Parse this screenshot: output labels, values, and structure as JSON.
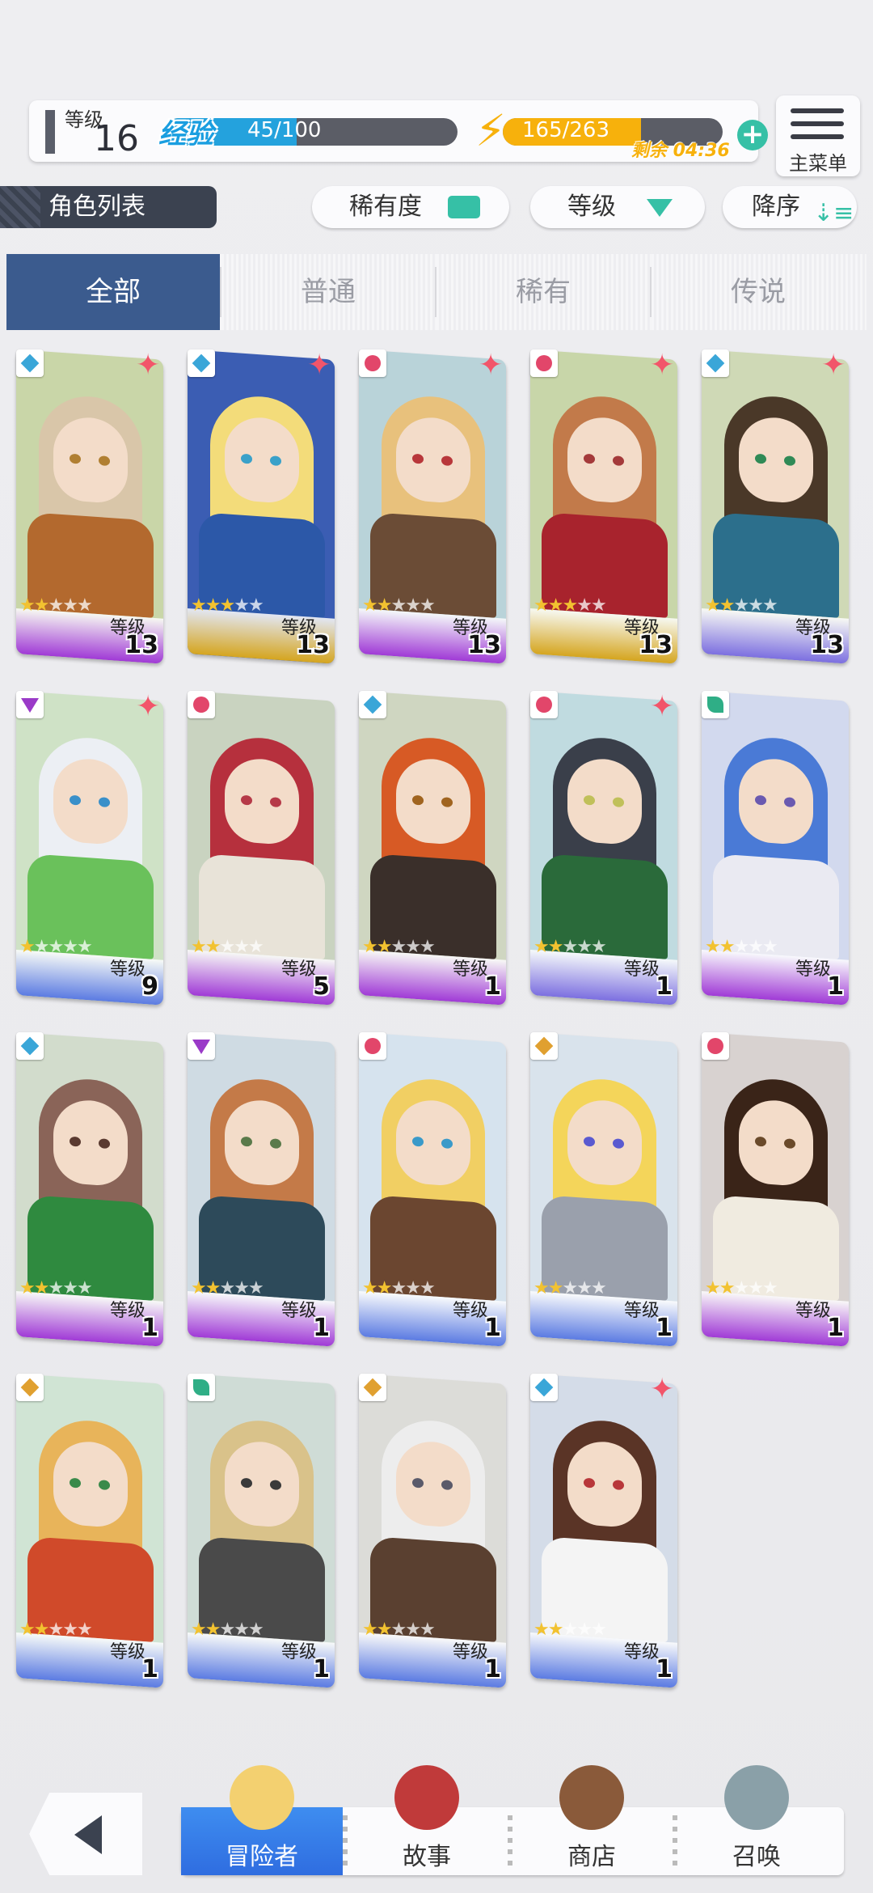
{
  "status": {
    "level_label": "等级",
    "level_value": "16",
    "exp_label": "经验",
    "exp_text": "45/100",
    "exp_progress": 0.45,
    "energy_text": "165/263",
    "energy_progress": 0.63,
    "remain_text": "剩余 04:36"
  },
  "main_menu": {
    "label": "主菜单"
  },
  "section_title": "角色列表",
  "sort": {
    "rarity_label": "稀有度",
    "level_label": "等级",
    "order_label": "降序"
  },
  "tabs": [
    {
      "label": "全部",
      "active": true
    },
    {
      "label": "普通",
      "active": false
    },
    {
      "label": "稀有",
      "active": false
    },
    {
      "label": "传说",
      "active": false
    }
  ],
  "cards": [
    {
      "attr": "water",
      "new": true,
      "stars": 2,
      "level_label": "等级",
      "level": "13",
      "band": "#a03ad6",
      "hair": "#d9c6a9",
      "outfit": "#b3692e",
      "eye": "#b07f32",
      "bg": "#c9d6a8"
    },
    {
      "attr": "water",
      "new": true,
      "stars": 3,
      "level_label": "等级",
      "level": "13",
      "band": "#d5a51f",
      "hair": "#f3dc7a",
      "outfit": "#2c58a8",
      "eye": "#3aa1c9",
      "bg": "#3b5db3"
    },
    {
      "attr": "fire",
      "new": true,
      "stars": 2,
      "level_label": "等级",
      "level": "13",
      "band": "#a03ad6",
      "hair": "#e8c17c",
      "outfit": "#6b4c36",
      "eye": "#b8373a",
      "bg": "#b9d3d9"
    },
    {
      "attr": "fire",
      "new": true,
      "stars": 3,
      "level_label": "等级",
      "level": "13",
      "band": "#d5a51f",
      "hair": "#c27a4a",
      "outfit": "#a8232d",
      "eye": "#a43a3a",
      "bg": "#c8d6a9"
    },
    {
      "attr": "water",
      "new": true,
      "stars": 2,
      "level_label": "等级",
      "level": "13",
      "band": "#7c6fe0",
      "hair": "#4a3828",
      "outfit": "#2c6f8c",
      "eye": "#2f8a56",
      "bg": "#cfd9b6"
    },
    {
      "attr": "dark",
      "new": true,
      "stars": 1,
      "level_label": "等级",
      "level": "9",
      "band": "#5b7be2",
      "hair": "#eceff4",
      "outfit": "#6ac15b",
      "eye": "#3a90c9",
      "bg": "#cfe2c6"
    },
    {
      "attr": "fire",
      "new": false,
      "stars": 2,
      "level_label": "等级",
      "level": "5",
      "band": "#a03ad6",
      "hair": "#b6303d",
      "outfit": "#e8e3d8",
      "eye": "#b63a48",
      "bg": "#c9d3c0"
    },
    {
      "attr": "water",
      "new": false,
      "stars": 2,
      "level_label": "等级",
      "level": "1",
      "band": "#a03ad6",
      "hair": "#d75a25",
      "outfit": "#3a2f2a",
      "eye": "#a0641f",
      "bg": "#cfd6c1"
    },
    {
      "attr": "fire",
      "new": true,
      "stars": 2,
      "level_label": "等级",
      "level": "1",
      "band": "#7c6fe0",
      "hair": "#3a3f4a",
      "outfit": "#2a6a3a",
      "eye": "#c0c05a",
      "bg": "#c0dbe0"
    },
    {
      "attr": "wind",
      "new": false,
      "stars": 2,
      "level_label": "等级",
      "level": "1",
      "band": "#a03ad6",
      "hair": "#4a7ad6",
      "outfit": "#eaeaf2",
      "eye": "#6a5ab0",
      "bg": "#d2d9ee"
    },
    {
      "attr": "water",
      "new": false,
      "stars": 2,
      "level_label": "等级",
      "level": "1",
      "band": "#a03ad6",
      "hair": "#8a6458",
      "outfit": "#2f8a3f",
      "eye": "#5a3a30",
      "bg": "#d2dccc"
    },
    {
      "attr": "dark",
      "new": false,
      "stars": 2,
      "level_label": "等级",
      "level": "1",
      "band": "#a03ad6",
      "hair": "#c47a48",
      "outfit": "#2d4a5a",
      "eye": "#5a7a4a",
      "bg": "#cfdbe3"
    },
    {
      "attr": "fire",
      "new": false,
      "stars": 2,
      "level_label": "等级",
      "level": "1",
      "band": "#5b7be2",
      "hair": "#f1cf63",
      "outfit": "#6b4630",
      "eye": "#3a9ac9",
      "bg": "#d6e3ee"
    },
    {
      "attr": "light",
      "new": false,
      "stars": 2,
      "level_label": "等级",
      "level": "1",
      "band": "#5b7be2",
      "hair": "#f4d55a",
      "outfit": "#9aa0ac",
      "eye": "#5a5ad0",
      "bg": "#d9e3ec"
    },
    {
      "attr": "fire",
      "new": false,
      "stars": 2,
      "level_label": "等级",
      "level": "1",
      "band": "#a03ad6",
      "hair": "#3a2418",
      "outfit": "#f0ebe0",
      "eye": "#6a4a2a",
      "bg": "#d8d2d0"
    },
    {
      "attr": "light",
      "new": false,
      "stars": 2,
      "level_label": "等级",
      "level": "1",
      "band": "#5b7be2",
      "hair": "#e8b45a",
      "outfit": "#d04a2a",
      "eye": "#3a8a4a",
      "bg": "#d0e4d4"
    },
    {
      "attr": "wind",
      "new": false,
      "stars": 2,
      "level_label": "等级",
      "level": "1",
      "band": "#5b7be2",
      "hair": "#d9c28a",
      "outfit": "#4a4a4a",
      "eye": "#3a3a3a",
      "bg": "#cfdcd6"
    },
    {
      "attr": "light",
      "new": false,
      "stars": 2,
      "level_label": "等级",
      "level": "1",
      "band": "#5b7be2",
      "hair": "#ededed",
      "outfit": "#5a4030",
      "eye": "#5a5a6a",
      "bg": "#dcdcd8"
    },
    {
      "attr": "water",
      "new": true,
      "stars": 2,
      "level_label": "等级",
      "level": "1",
      "band": "#5b7be2",
      "hair": "#5a3426",
      "outfit": "#f4f4f4",
      "eye": "#b8373a",
      "bg": "#d4dce8"
    }
  ],
  "nav": {
    "items": [
      {
        "label": "冒险者",
        "active": true
      },
      {
        "label": "故事",
        "active": false
      },
      {
        "label": "商店",
        "active": false
      },
      {
        "label": "召唤",
        "active": false
      }
    ]
  },
  "colors": {
    "accent": "#36c0a6",
    "tab_active": "#3b5b8e",
    "exp": "#24a2dd",
    "energy": "#f7b10c",
    "new_sparkle": "#f2556a"
  }
}
